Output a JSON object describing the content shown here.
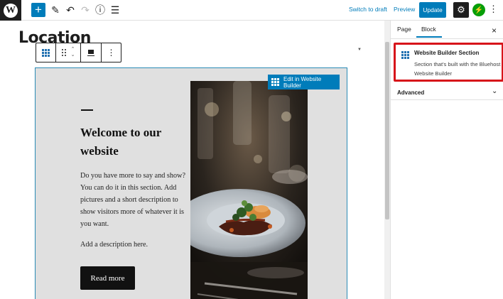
{
  "toolbar": {
    "logo_glyph": "W",
    "add_glyph": "+",
    "tools_glyph": "✎",
    "undo_glyph": "↶",
    "redo_glyph": "↷",
    "info_glyph": "ⓘ",
    "outline_glyph": "☰",
    "switch_to_draft": "Switch to draft",
    "preview": "Preview",
    "update": "Update",
    "settings_glyph": "⚙",
    "jetpack_glyph": "⚡",
    "more_glyph": "⋮"
  },
  "editor": {
    "page_title": "Location",
    "block_toolbar": {
      "up_glyph": "⌃",
      "down_glyph": "⌄",
      "more_glyph": "⋮"
    },
    "section": {
      "edit_button": "Edit in Website Builder",
      "heading": "Welcome to our website",
      "body": "Do you have more to say and show? You can do it in this section. Add pictures and a short description to show visitors more of whatever it is you want.",
      "description": "Add a description here.",
      "read_more": "Read more"
    },
    "scroll_arrow_glyph": "▼"
  },
  "sidebar": {
    "tabs": [
      {
        "label": "Page",
        "active": false
      },
      {
        "label": "Block",
        "active": true
      }
    ],
    "close_glyph": "×",
    "block_card": {
      "title": "Website Builder Section",
      "description": "Section that's built with the Bluehost Website Builder"
    },
    "advanced": {
      "label": "Advanced",
      "chevron_glyph": "⌄"
    }
  },
  "colors": {
    "accent": "#007cba",
    "highlight": "#d7141a",
    "section_bg": "#e0e0e0",
    "jetpack": "#069e08"
  }
}
